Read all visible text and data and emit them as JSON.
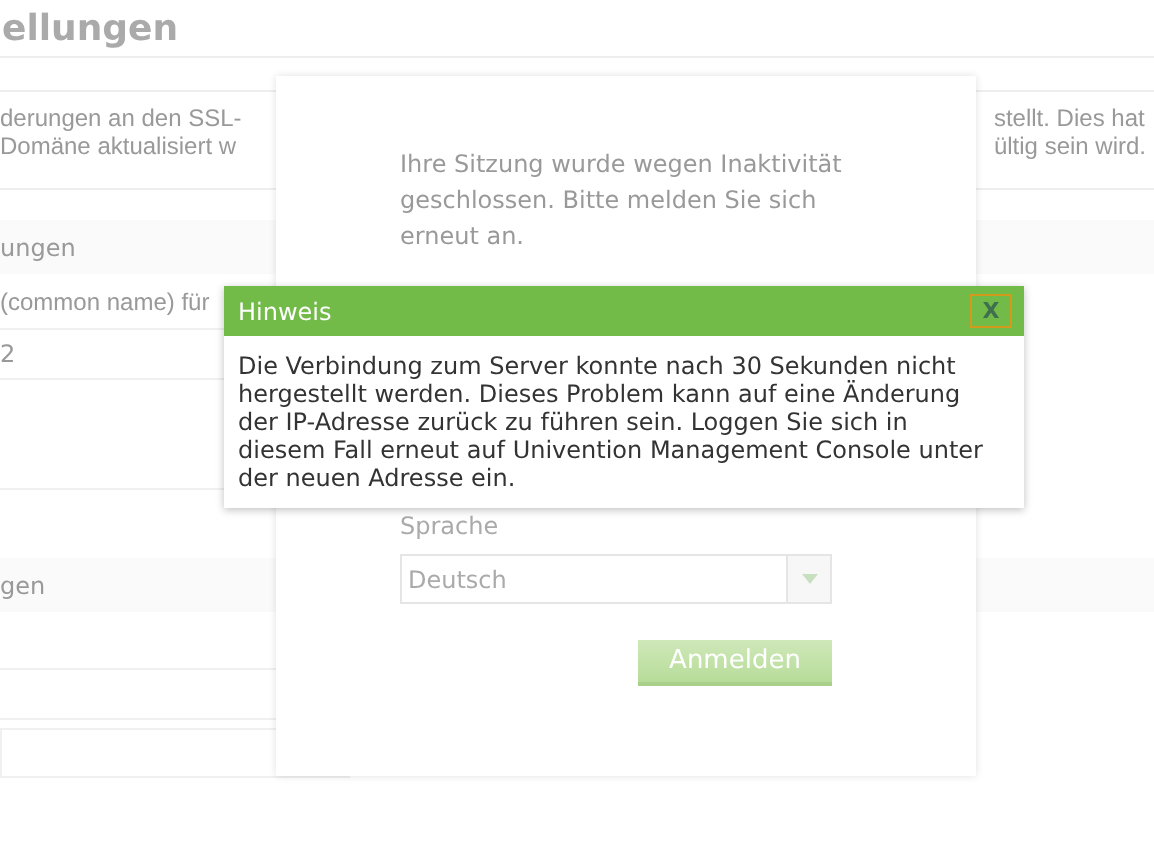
{
  "page": {
    "title": "ellungen",
    "info_left": [
      "derungen an den SSL-",
      "Domäne aktualisiert w"
    ],
    "info_right": [
      "stellt. Dies hat",
      "ültig sein wird."
    ],
    "section_1": "ungen",
    "row_1": "(common name) für",
    "row_2": "2",
    "section_2": "gen"
  },
  "login_dialog": {
    "message": "Ihre Sitzung wurde wegen Inaktivität geschlossen. Bitte melden Sie sich erneut an.",
    "language_label": "Sprache",
    "language_value": "Deutsch",
    "submit": "Anmelden",
    "disabled": true
  },
  "notice_dialog": {
    "title": "Hinweis",
    "close": "X",
    "message": "Die Verbindung zum Server konnte nach 30 Sekunden nicht hergestellt werden. Dieses Problem kann auf eine Änderung der IP-Adresse zurück zu führen sein. Loggen Sie sich in diesem Fall erneut auf Univention Management Console unter der neuen Adresse ein."
  }
}
